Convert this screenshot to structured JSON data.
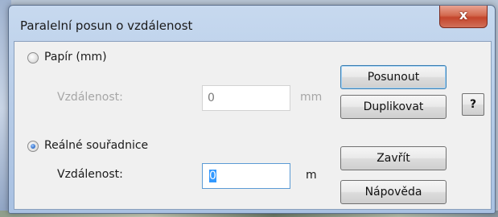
{
  "window": {
    "title": "Paralelní posun o vzdálenost",
    "close_glyph": "x"
  },
  "paper": {
    "radio_label": "Papír (mm)",
    "selected": false,
    "distance_label": "Vzdálenost:",
    "distance_value": "0",
    "unit": "mm"
  },
  "real": {
    "radio_label": "Reálné souřadnice",
    "selected": true,
    "distance_label": "Vzdálenost:",
    "distance_value": "0",
    "unit": "m"
  },
  "buttons": {
    "move": "Posunout",
    "duplicate": "Duplikovat",
    "help_icon": "?",
    "close": "Zavřít",
    "help": "Nápověda"
  }
}
